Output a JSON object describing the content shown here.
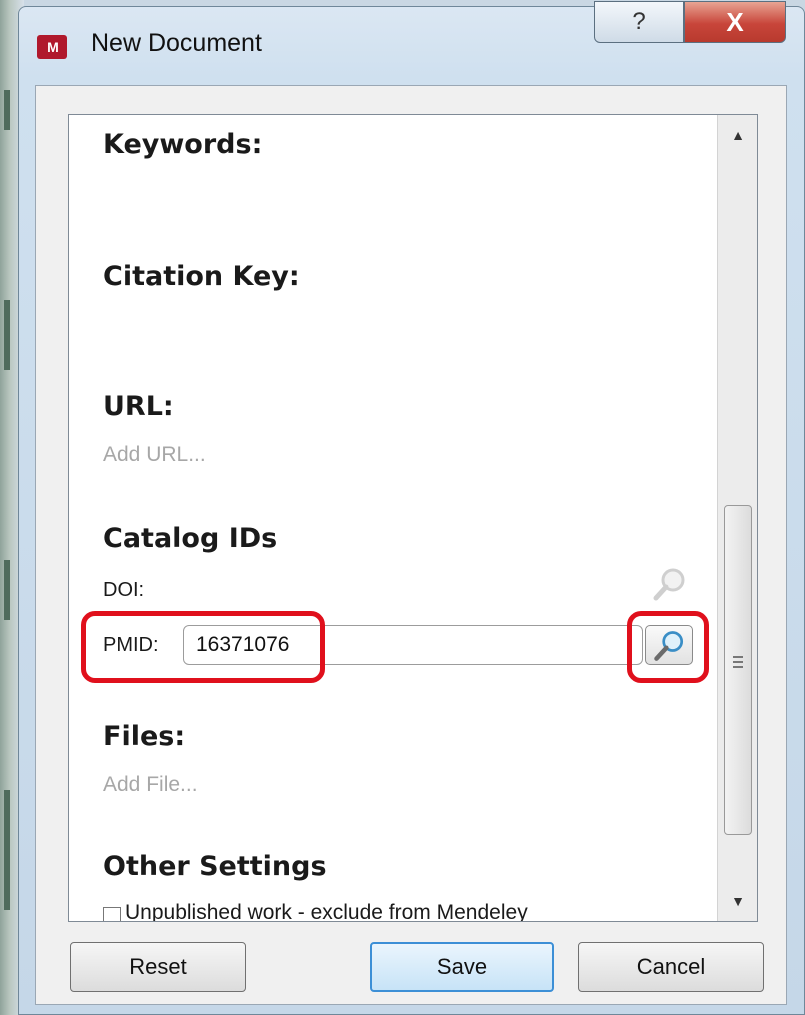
{
  "window": {
    "title": "New Document",
    "logo_text": "M",
    "help_glyph": "?",
    "close_glyph": "X"
  },
  "sections": {
    "keywords": "Keywords:",
    "citation_key": "Citation Key:",
    "url": "URL:",
    "url_placeholder": "Add URL...",
    "catalog_ids": "Catalog IDs",
    "doi_label": "DOI:",
    "pmid_label": "PMID:",
    "pmid_value": "16371076",
    "files": "Files:",
    "files_placeholder": "Add File...",
    "other_settings": "Other Settings",
    "unpublished_label": "Unpublished work - exclude from Mendeley"
  },
  "buttons": {
    "reset": "Reset",
    "save": "Save",
    "cancel": "Cancel"
  },
  "colors": {
    "highlight": "#e0101c",
    "accent": "#3c8fd6",
    "brand": "#b0182c"
  },
  "icons": [
    "magnifier-icon",
    "help-icon",
    "close-icon",
    "app-logo"
  ]
}
